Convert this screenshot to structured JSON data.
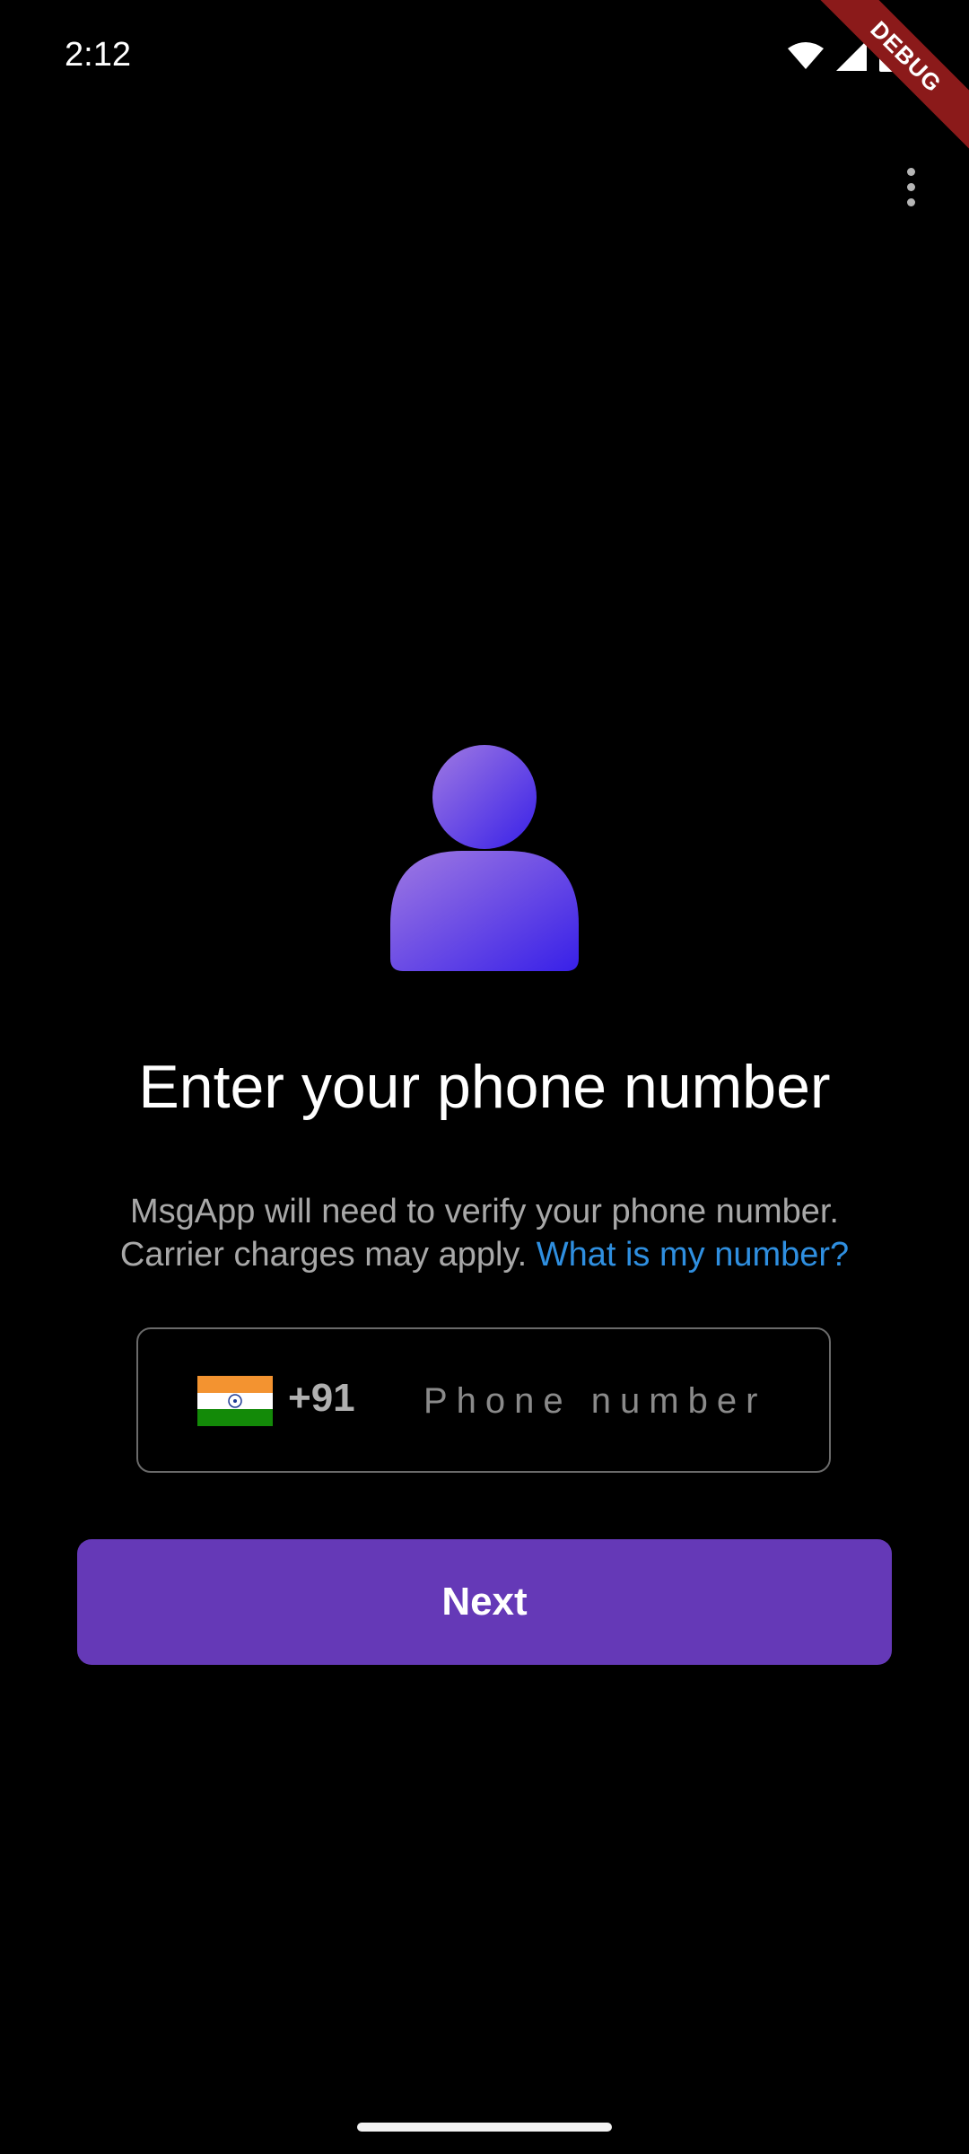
{
  "status_bar": {
    "time": "2:12",
    "icons": [
      "wifi-icon",
      "cellular-signal-icon",
      "battery-icon"
    ]
  },
  "debug_banner": {
    "label": "DEBUG",
    "color": "#8b1a1a"
  },
  "app_bar": {
    "menu_icon": "more-vert-icon"
  },
  "main": {
    "avatar_icon": "person-icon",
    "avatar_gradient": [
      "#9b6fe0",
      "#3d22e6"
    ],
    "title": "Enter your phone number",
    "description_line1": "MsgApp will need to verify your phone number.",
    "description_line2": "Carrier charges may apply.",
    "link_label": "What is my number?",
    "link_color": "#2f8fe0"
  },
  "phone_field": {
    "country_flag": "india-flag-icon",
    "dial_code": "+91",
    "placeholder": "Phone number",
    "value": ""
  },
  "actions": {
    "next_label": "Next",
    "next_color": "#6539b7"
  }
}
